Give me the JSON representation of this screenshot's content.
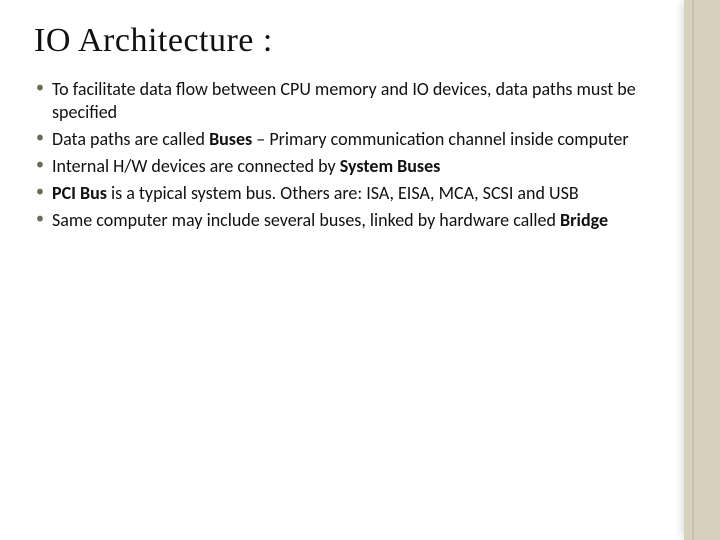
{
  "title": "IO Architecture :",
  "bullets": [
    {
      "segments": [
        {
          "text": "To facilitate data flow between CPU memory and IO devices, data paths must be specified",
          "bold": false
        }
      ]
    },
    {
      "segments": [
        {
          "text": "Data paths are called ",
          "bold": false
        },
        {
          "text": "Buses",
          "bold": true
        },
        {
          "text": " – Primary communication channel inside computer",
          "bold": false
        }
      ]
    },
    {
      "segments": [
        {
          "text": "Internal H/W devices are connected by ",
          "bold": false
        },
        {
          "text": "System Buses",
          "bold": true
        }
      ]
    },
    {
      "segments": [
        {
          "text": "PCI Bus",
          "bold": true
        },
        {
          "text": " is a typical system bus. Others are: ISA, EISA, MCA, SCSI and USB",
          "bold": false
        }
      ]
    },
    {
      "segments": [
        {
          "text": "Same computer may include several buses, linked by hardware called ",
          "bold": false
        },
        {
          "text": "Bridge",
          "bold": true
        }
      ]
    }
  ]
}
